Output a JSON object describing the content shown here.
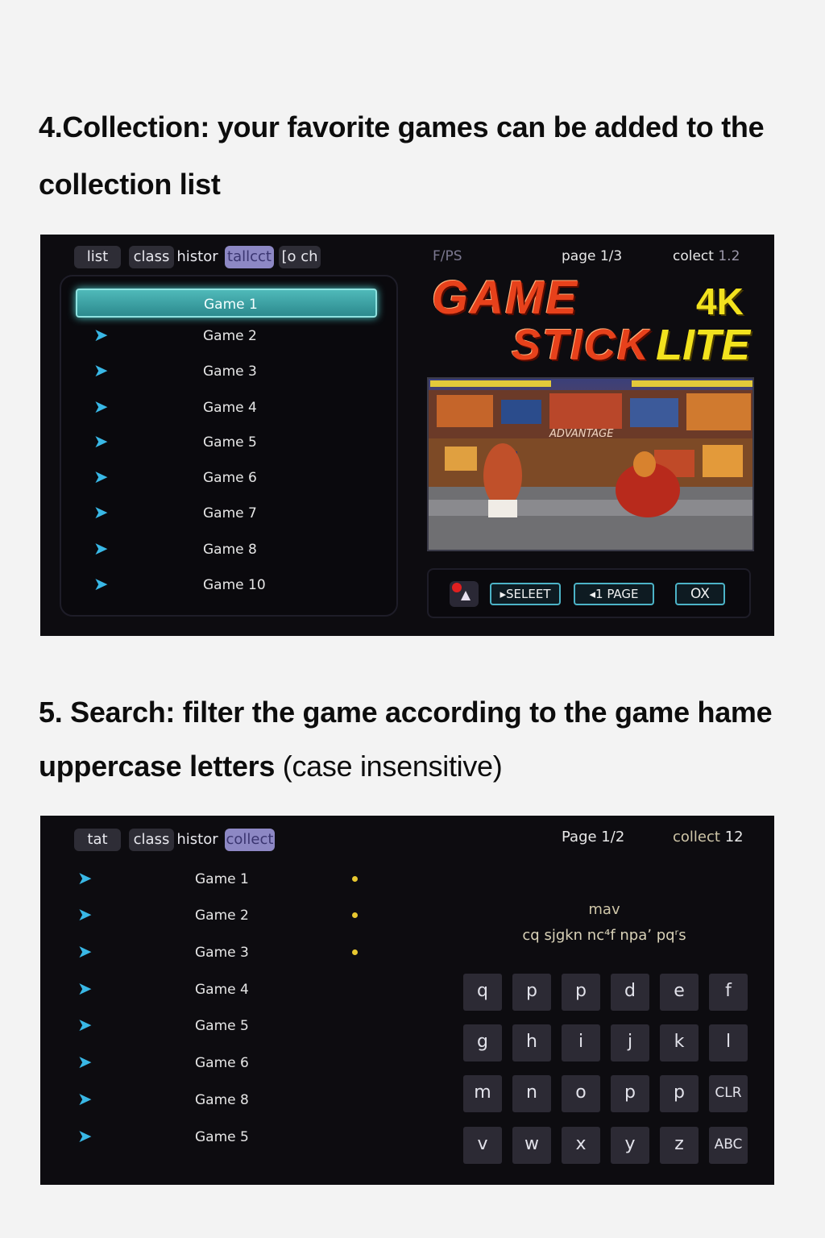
{
  "section4": {
    "heading": "4.Collection: your favorite games can be added to the collection list",
    "tabs": [
      "list",
      "class",
      "histor",
      "tallcct",
      "[o ch"
    ],
    "genre": "F/PS",
    "page": "page 1/3",
    "collect_label": "colect",
    "collect_value": "1.2",
    "logo": {
      "line1": "GAME",
      "line2": "STICK",
      "lite": "LITE",
      "res": "4K"
    },
    "preview_text": "ADVANTAGE",
    "games": [
      "Game 1",
      "Game 2",
      "Game 3",
      "Game 4",
      "Game 5",
      "Game 6",
      "Game 7",
      "Game 8",
      "Game 10"
    ],
    "buttons": {
      "select": "SELEET",
      "page": "1 PAGE",
      "ok": "OX"
    },
    "colors": {
      "accent": "#3aa6a8",
      "arrow": "#39b8e6",
      "tab_active": "#8d88c4"
    }
  },
  "section5": {
    "heading_bold": "5. Search: filter the game according to the game hame uppercase letters",
    "heading_light": "(case insensitive)",
    "tabs": [
      "tat",
      "class",
      "histor",
      "collect"
    ],
    "page": "Page 1/2",
    "collect_label": "collect",
    "collect_value": "12",
    "search_title": "mav",
    "search_hint": "cq sjgkn nc⁴f npaʼ pqʳs",
    "games": [
      "Game 1",
      "Game 2",
      "Game 3",
      "Game 4",
      "Game 5",
      "Game 6",
      "Game 8",
      "Game 5"
    ],
    "keys": [
      "q",
      "p",
      "p",
      "d",
      "e",
      "f",
      "g",
      "h",
      "i",
      "j",
      "k",
      "l",
      "m",
      "n",
      "o",
      "p",
      "p",
      "CLR",
      "v",
      "w",
      "x",
      "y",
      "z",
      "ABC"
    ]
  }
}
